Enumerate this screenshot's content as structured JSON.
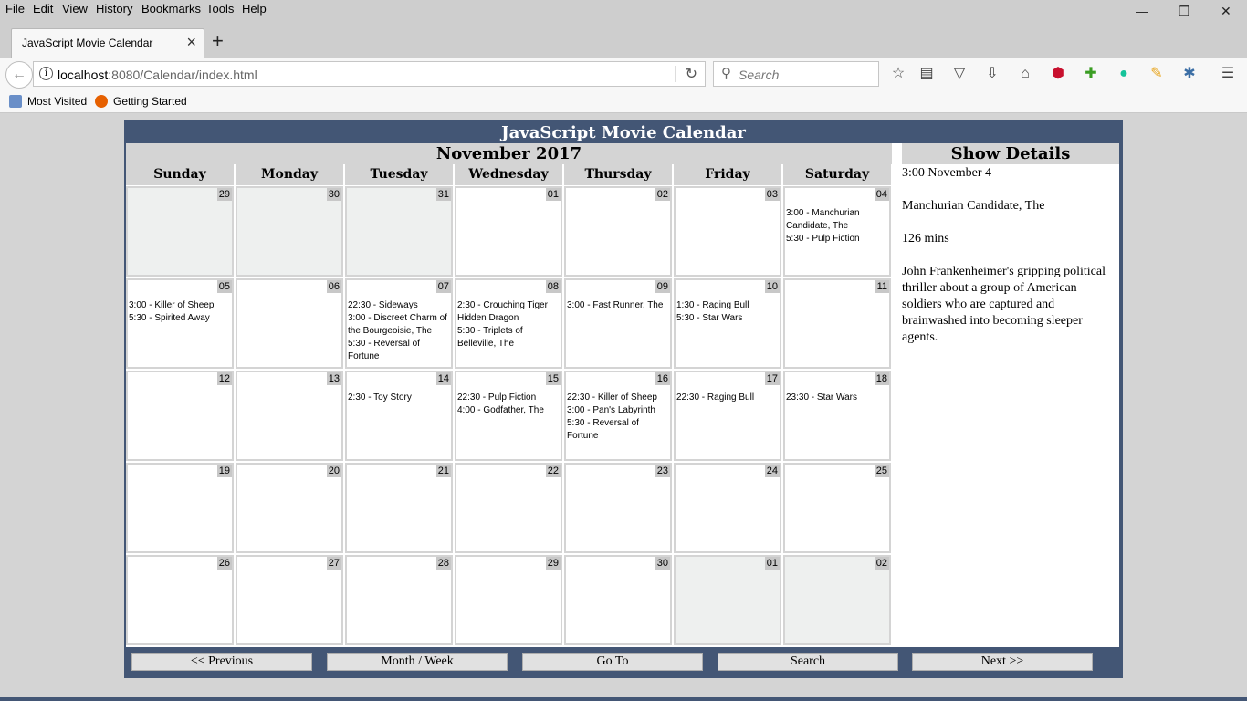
{
  "browser": {
    "menu": [
      "File",
      "Edit",
      "View",
      "History",
      "Bookmarks",
      "Tools",
      "Help"
    ],
    "tab_title": "JavaScript Movie Calendar",
    "url_host": "localhost",
    "url_path": ":8080/Calendar/index.html",
    "search_placeholder": "Search",
    "bookmarks": [
      "Most Visited",
      "Getting Started"
    ]
  },
  "app": {
    "title": "JavaScript Movie Calendar",
    "month_label": "November 2017",
    "day_names": [
      "Sunday",
      "Monday",
      "Tuesday",
      "Wednesday",
      "Thursday",
      "Friday",
      "Saturday"
    ],
    "weeks": [
      [
        {
          "day": "29",
          "other": true,
          "events": []
        },
        {
          "day": "30",
          "other": true,
          "events": []
        },
        {
          "day": "31",
          "other": true,
          "events": []
        },
        {
          "day": "01",
          "other": false,
          "events": []
        },
        {
          "day": "02",
          "other": false,
          "events": []
        },
        {
          "day": "03",
          "other": false,
          "events": []
        },
        {
          "day": "04",
          "other": false,
          "events": [
            "3:00 - Manchurian Candidate, The",
            "5:30 - Pulp Fiction"
          ]
        }
      ],
      [
        {
          "day": "05",
          "other": false,
          "events": [
            "3:00 - Killer of Sheep",
            "5:30 - Spirited Away"
          ]
        },
        {
          "day": "06",
          "other": false,
          "events": []
        },
        {
          "day": "07",
          "other": false,
          "events": [
            "22:30 - Sideways",
            "3:00 - Discreet Charm of the Bourgeoisie, The",
            "5:30 - Reversal of Fortune"
          ]
        },
        {
          "day": "08",
          "other": false,
          "events": [
            "2:30 - Crouching Tiger Hidden Dragon",
            "5:30 - Triplets of Belleville, The"
          ]
        },
        {
          "day": "09",
          "other": false,
          "events": [
            "3:00 - Fast Runner, The"
          ]
        },
        {
          "day": "10",
          "other": false,
          "events": [
            "1:30 - Raging Bull",
            "5:30 - Star Wars"
          ]
        },
        {
          "day": "11",
          "other": false,
          "events": []
        }
      ],
      [
        {
          "day": "12",
          "other": false,
          "events": []
        },
        {
          "day": "13",
          "other": false,
          "events": []
        },
        {
          "day": "14",
          "other": false,
          "events": [
            "2:30 - Toy Story"
          ]
        },
        {
          "day": "15",
          "other": false,
          "events": [
            "22:30 - Pulp Fiction",
            "4:00 - Godfather, The"
          ]
        },
        {
          "day": "16",
          "other": false,
          "events": [
            "22:30 - Killer of Sheep",
            "3:00 - Pan's Labyrinth",
            "5:30 - Reversal of Fortune"
          ]
        },
        {
          "day": "17",
          "other": false,
          "events": [
            "22:30 - Raging Bull"
          ]
        },
        {
          "day": "18",
          "other": false,
          "events": [
            "23:30 - Star Wars"
          ]
        }
      ],
      [
        {
          "day": "19",
          "other": false,
          "events": []
        },
        {
          "day": "20",
          "other": false,
          "events": []
        },
        {
          "day": "21",
          "other": false,
          "events": []
        },
        {
          "day": "22",
          "other": false,
          "events": []
        },
        {
          "day": "23",
          "other": false,
          "events": []
        },
        {
          "day": "24",
          "other": false,
          "events": []
        },
        {
          "day": "25",
          "other": false,
          "events": []
        }
      ],
      [
        {
          "day": "26",
          "other": false,
          "events": []
        },
        {
          "day": "27",
          "other": false,
          "events": []
        },
        {
          "day": "28",
          "other": false,
          "events": []
        },
        {
          "day": "29",
          "other": false,
          "events": []
        },
        {
          "day": "30",
          "other": false,
          "events": []
        },
        {
          "day": "01",
          "other": true,
          "events": []
        },
        {
          "day": "02",
          "other": true,
          "events": []
        }
      ]
    ],
    "details": {
      "header": "Show Details",
      "when": "3:00 November 4",
      "title": "Manchurian Candidate, The",
      "runtime": "126 mins",
      "description": "John Frankenheimer's gripping political thriller about a group of American soldiers who are captured and brainwashed into becoming sleeper agents."
    },
    "buttons": {
      "previous": "<< Previous",
      "month_week": "Month / Week",
      "goto": "Go To",
      "search": "Search",
      "next": "Next >>"
    }
  },
  "colors": {
    "header_bar": "#435675",
    "other_month": "#eef0ef",
    "grid": "#d4d4d4"
  }
}
